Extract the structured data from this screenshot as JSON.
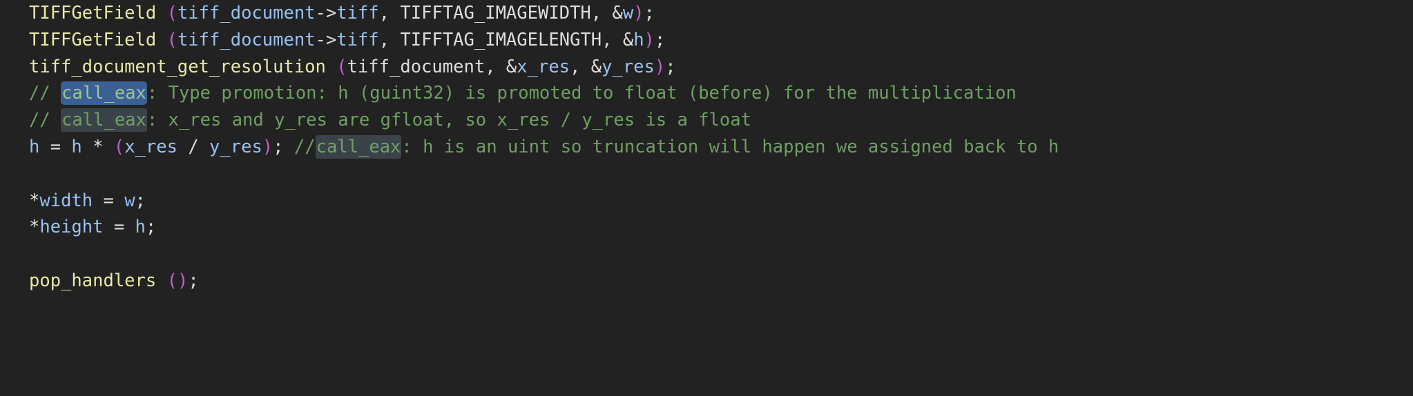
{
  "editor": {
    "background_color": "#222222",
    "font": "monospace",
    "language": "C",
    "colors": {
      "function": "#e9e9a8",
      "paren": "#c061cb",
      "identifier": "#99c1f1",
      "punctuation": "#deddda",
      "comment": "#6f9f63",
      "highlight_blue": "#3a6096",
      "highlight_gray": "#3b434a"
    },
    "lines": [
      {
        "index": 1,
        "text": "TIFFGetField (tiff_document->tiff, TIFFTAG_IMAGEWIDTH, &w);",
        "tokens": [
          {
            "t": "TIFFGetField",
            "c": "fn"
          },
          {
            "t": " ",
            "c": "punct"
          },
          {
            "t": "(",
            "c": "paren"
          },
          {
            "t": "tiff_document",
            "c": "var"
          },
          {
            "t": "->",
            "c": "punct"
          },
          {
            "t": "tiff",
            "c": "var"
          },
          {
            "t": ", ",
            "c": "punct"
          },
          {
            "t": "TIFFTAG_IMAGEWIDTH",
            "c": "const"
          },
          {
            "t": ", ",
            "c": "punct"
          },
          {
            "t": "&",
            "c": "punct"
          },
          {
            "t": "w",
            "c": "var"
          },
          {
            "t": ")",
            "c": "paren"
          },
          {
            "t": ";",
            "c": "punct"
          }
        ]
      },
      {
        "index": 2,
        "text": "TIFFGetField (tiff_document->tiff, TIFFTAG_IMAGELENGTH, &h);",
        "tokens": [
          {
            "t": "TIFFGetField",
            "c": "fn"
          },
          {
            "t": " ",
            "c": "punct"
          },
          {
            "t": "(",
            "c": "paren"
          },
          {
            "t": "tiff_document",
            "c": "var"
          },
          {
            "t": "->",
            "c": "punct"
          },
          {
            "t": "tiff",
            "c": "var"
          },
          {
            "t": ", ",
            "c": "punct"
          },
          {
            "t": "TIFFTAG_IMAGELENGTH",
            "c": "const"
          },
          {
            "t": ", ",
            "c": "punct"
          },
          {
            "t": "&",
            "c": "punct"
          },
          {
            "t": "h",
            "c": "var"
          },
          {
            "t": ")",
            "c": "paren"
          },
          {
            "t": ";",
            "c": "punct"
          }
        ]
      },
      {
        "index": 3,
        "text": "tiff_document_get_resolution (tiff_document, &x_res, &y_res);",
        "tokens": [
          {
            "t": "tiff_document_get_resolution",
            "c": "fn"
          },
          {
            "t": " ",
            "c": "punct"
          },
          {
            "t": "(",
            "c": "paren"
          },
          {
            "t": "tiff_document",
            "c": "const"
          },
          {
            "t": ", ",
            "c": "punct"
          },
          {
            "t": "&",
            "c": "punct"
          },
          {
            "t": "x_res",
            "c": "var"
          },
          {
            "t": ", ",
            "c": "punct"
          },
          {
            "t": "&",
            "c": "punct"
          },
          {
            "t": "y_res",
            "c": "var"
          },
          {
            "t": ")",
            "c": "paren"
          },
          {
            "t": ";",
            "c": "punct"
          }
        ]
      },
      {
        "index": 4,
        "text": "// call_eax: Type promotion: h (guint32) is promoted to float (before) for the multiplication",
        "tokens": [
          {
            "t": "// ",
            "c": "comment"
          },
          {
            "t": "call_eax",
            "c": "hl-blue"
          },
          {
            "t": ": Type promotion: h (guint32) is promoted to float (before) for the multiplication",
            "c": "comment"
          }
        ]
      },
      {
        "index": 5,
        "text": "// call_eax: x_res and y_res are gfloat, so x_res / y_res is a float",
        "tokens": [
          {
            "t": "// ",
            "c": "comment"
          },
          {
            "t": "call_eax",
            "c": "hl-gray"
          },
          {
            "t": ": x_res and y_res are gfloat, so x_res / y_res is a float",
            "c": "comment"
          }
        ]
      },
      {
        "index": 6,
        "text": "h = h * (x_res / y_res); //call_eax: h is an uint so truncation will happen we assigned back to h",
        "tokens": [
          {
            "t": "h",
            "c": "var"
          },
          {
            "t": " = ",
            "c": "op"
          },
          {
            "t": "h",
            "c": "var"
          },
          {
            "t": " * ",
            "c": "op"
          },
          {
            "t": "(",
            "c": "paren"
          },
          {
            "t": "x_res",
            "c": "var"
          },
          {
            "t": " / ",
            "c": "op"
          },
          {
            "t": "y_res",
            "c": "var"
          },
          {
            "t": ")",
            "c": "paren"
          },
          {
            "t": "; ",
            "c": "punct"
          },
          {
            "t": "//",
            "c": "comment"
          },
          {
            "t": "call_eax",
            "c": "hl-gray"
          },
          {
            "t": ": h is an uint so truncation will happen we assigned back to h",
            "c": "comment"
          }
        ]
      },
      {
        "index": 7,
        "text": "",
        "tokens": []
      },
      {
        "index": 8,
        "text": "*width = w;",
        "tokens": [
          {
            "t": "*",
            "c": "punct"
          },
          {
            "t": "width",
            "c": "var"
          },
          {
            "t": " = ",
            "c": "op"
          },
          {
            "t": "w",
            "c": "var"
          },
          {
            "t": ";",
            "c": "punct"
          }
        ]
      },
      {
        "index": 9,
        "text": "*height = h;",
        "tokens": [
          {
            "t": "*",
            "c": "punct"
          },
          {
            "t": "height",
            "c": "var"
          },
          {
            "t": " = ",
            "c": "op"
          },
          {
            "t": "h",
            "c": "var"
          },
          {
            "t": ";",
            "c": "punct"
          }
        ]
      },
      {
        "index": 10,
        "text": "",
        "tokens": []
      },
      {
        "index": 11,
        "text": "pop_handlers ();",
        "tokens": [
          {
            "t": "pop_handlers",
            "c": "fn"
          },
          {
            "t": " ",
            "c": "punct"
          },
          {
            "t": "(",
            "c": "paren"
          },
          {
            "t": ")",
            "c": "paren"
          },
          {
            "t": ";",
            "c": "punct"
          }
        ]
      }
    ]
  }
}
